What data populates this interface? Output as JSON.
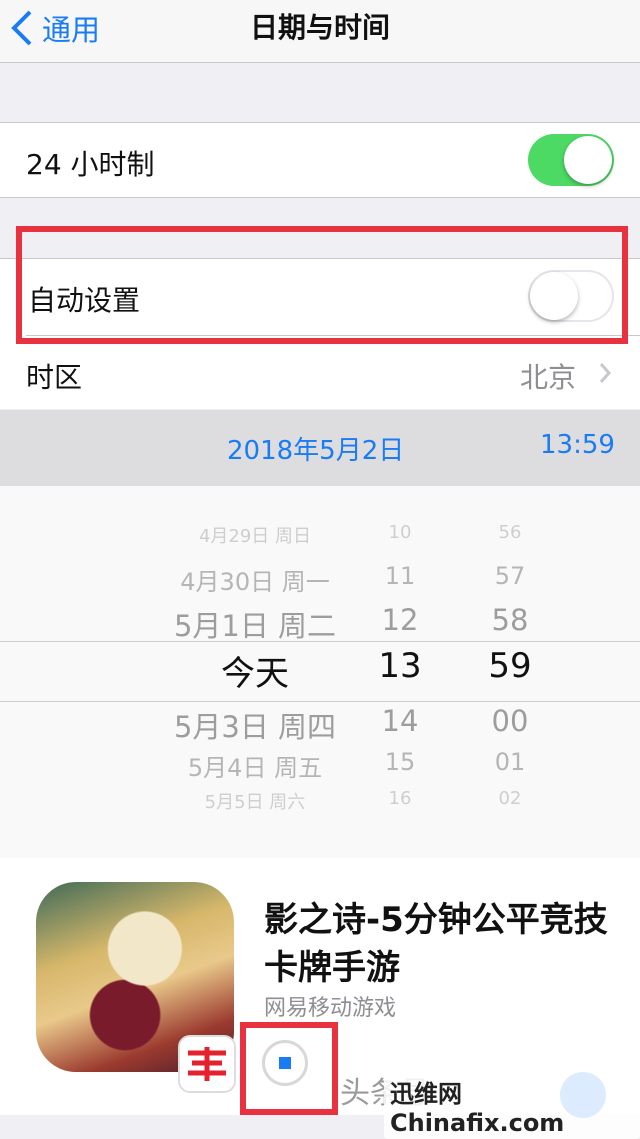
{
  "navbar": {
    "back_label": "通用",
    "title": "日期与时间"
  },
  "rows": {
    "hour24": {
      "label": "24 小时制",
      "on": true
    },
    "auto": {
      "label": "自动设置",
      "on": false
    },
    "timezone": {
      "label": "时区",
      "value": "北京"
    }
  },
  "datebar": {
    "date": "2018年5月2日",
    "time": "13:59"
  },
  "picker": {
    "dates": [
      "4月29日 周日",
      "4月30日 周一",
      "5月1日 周二",
      "今天",
      "5月3日 周四",
      "5月4日 周五",
      "5月5日 周六"
    ],
    "hours": [
      "10",
      "11",
      "12",
      "13",
      "14",
      "15",
      "16"
    ],
    "minutes": [
      "56",
      "57",
      "58",
      "59",
      "00",
      "01",
      "02"
    ]
  },
  "ad": {
    "title": "影之诗-5分钟公平竞技卡牌手游",
    "publisher": "网易移动游戏"
  },
  "watermark": {
    "text": "头条号",
    "site": "迅维网 Chinafix.com"
  },
  "colors": {
    "accent": "#1a7cf5",
    "toggle_on": "#4cd964",
    "highlight_box": "#e8323f"
  }
}
